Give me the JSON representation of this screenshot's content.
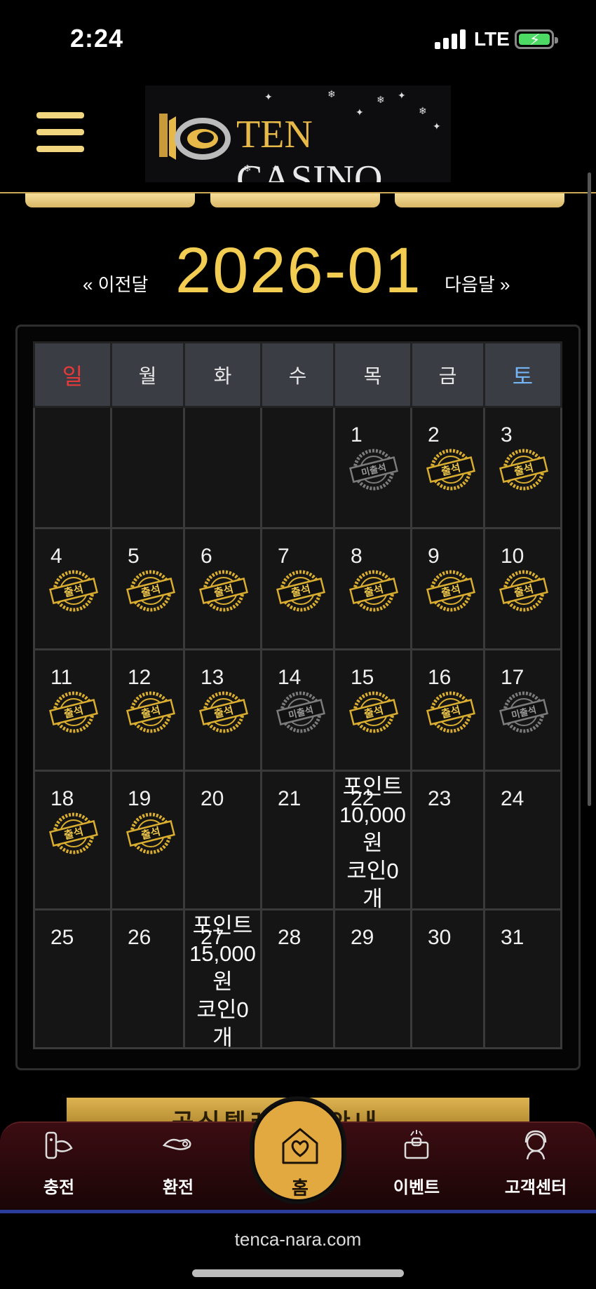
{
  "status_bar": {
    "time": "2:24",
    "network": "LTE"
  },
  "header": {
    "logo_text_ten": "TEN",
    "logo_text_casino": "CASINO"
  },
  "month_nav": {
    "prev": "« 이전달",
    "title": "2026-01",
    "next": "다음달 »"
  },
  "calendar": {
    "weekdays": [
      "일",
      "월",
      "화",
      "수",
      "목",
      "금",
      "토"
    ],
    "stamp_labels": {
      "attended": "출석",
      "missed": "미출석"
    },
    "weeks": [
      [
        {
          "day": ""
        },
        {
          "day": ""
        },
        {
          "day": ""
        },
        {
          "day": ""
        },
        {
          "day": "1",
          "stamp": "missed"
        },
        {
          "day": "2",
          "stamp": "attended"
        },
        {
          "day": "3",
          "stamp": "attended"
        }
      ],
      [
        {
          "day": "4",
          "stamp": "attended"
        },
        {
          "day": "5",
          "stamp": "attended"
        },
        {
          "day": "6",
          "stamp": "attended"
        },
        {
          "day": "7",
          "stamp": "attended"
        },
        {
          "day": "8",
          "stamp": "attended"
        },
        {
          "day": "9",
          "stamp": "attended"
        },
        {
          "day": "10",
          "stamp": "attended"
        }
      ],
      [
        {
          "day": "11",
          "stamp": "attended"
        },
        {
          "day": "12",
          "stamp": "attended"
        },
        {
          "day": "13",
          "stamp": "attended"
        },
        {
          "day": "14",
          "stamp": "missed"
        },
        {
          "day": "15",
          "stamp": "attended"
        },
        {
          "day": "16",
          "stamp": "attended"
        },
        {
          "day": "17",
          "stamp": "missed"
        }
      ],
      [
        {
          "day": "18",
          "stamp": "attended"
        },
        {
          "day": "19",
          "stamp": "attended"
        },
        {
          "day": "20"
        },
        {
          "day": "21"
        },
        {
          "day": "22",
          "reward": [
            "포인트",
            "10,000",
            "원",
            "코인0",
            "개"
          ]
        },
        {
          "day": "23"
        },
        {
          "day": "24"
        }
      ],
      [
        {
          "day": "25"
        },
        {
          "day": "26"
        },
        {
          "day": "27",
          "reward": [
            "포인트",
            "15,000",
            "원",
            "코인0",
            "개"
          ]
        },
        {
          "day": "28"
        },
        {
          "day": "29"
        },
        {
          "day": "30"
        },
        {
          "day": "31"
        }
      ]
    ]
  },
  "banner": {
    "text": "공식텔레그램안내"
  },
  "bottom_nav": {
    "charge": "충전",
    "exchange": "환전",
    "home": "홈",
    "event": "이벤트",
    "support": "고객센터"
  },
  "browser": {
    "url": "tenca-nara.com"
  },
  "colors": {
    "gold": "#f3cd52",
    "sunday": "#e43a3a",
    "saturday": "#74b4f4",
    "home_button": "#e3a941"
  }
}
